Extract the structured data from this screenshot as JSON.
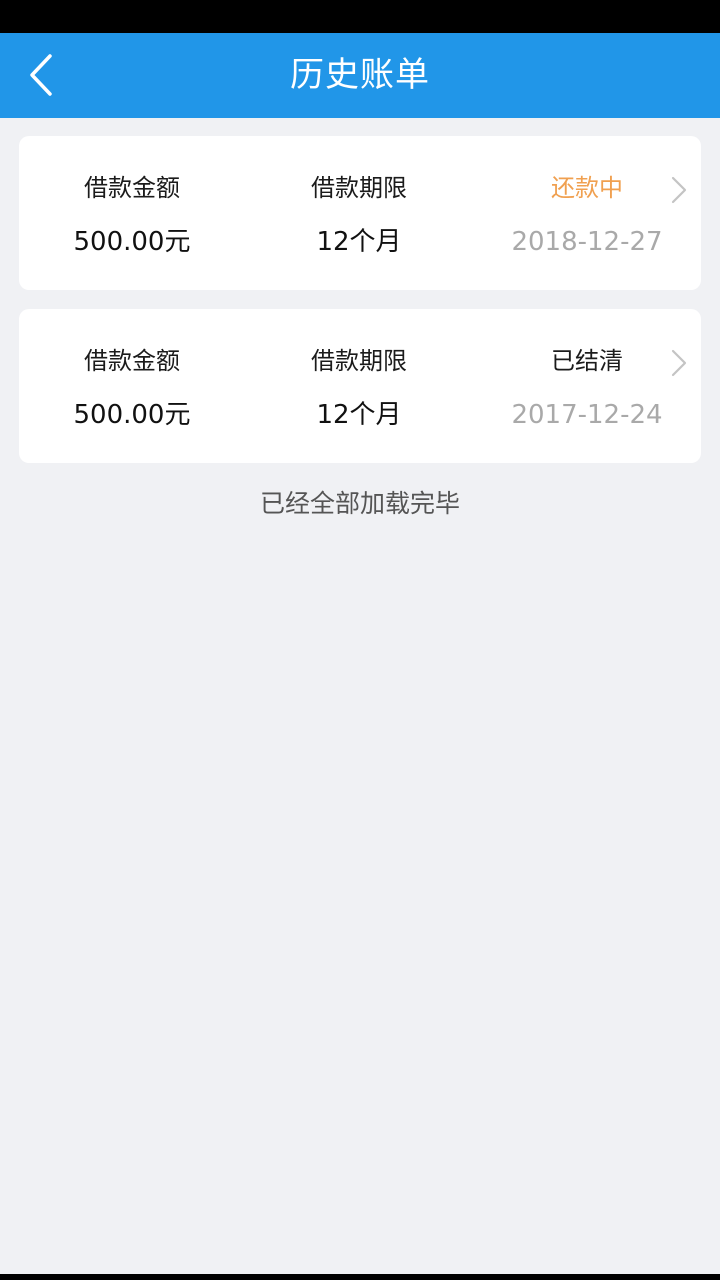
{
  "header": {
    "title": "历史账单",
    "back_icon": "chevron-left-icon"
  },
  "bills": [
    {
      "amount_label": "借款金额",
      "amount_value": "500.00元",
      "term_label": "借款期限",
      "term_value": "12个月",
      "status": "还款中",
      "status_color": "#f0a050",
      "date": "2018-12-27"
    },
    {
      "amount_label": "借款金额",
      "amount_value": "500.00元",
      "term_label": "借款期限",
      "term_value": "12个月",
      "status": "已结清",
      "status_color": "#1b1b1b",
      "date": "2017-12-24"
    }
  ],
  "footer": {
    "loaded_text": "已经全部加载完毕"
  },
  "colors": {
    "nav_bar": "#2196e8",
    "background": "#f0f1f4",
    "date_gray": "#a9a9a9"
  }
}
